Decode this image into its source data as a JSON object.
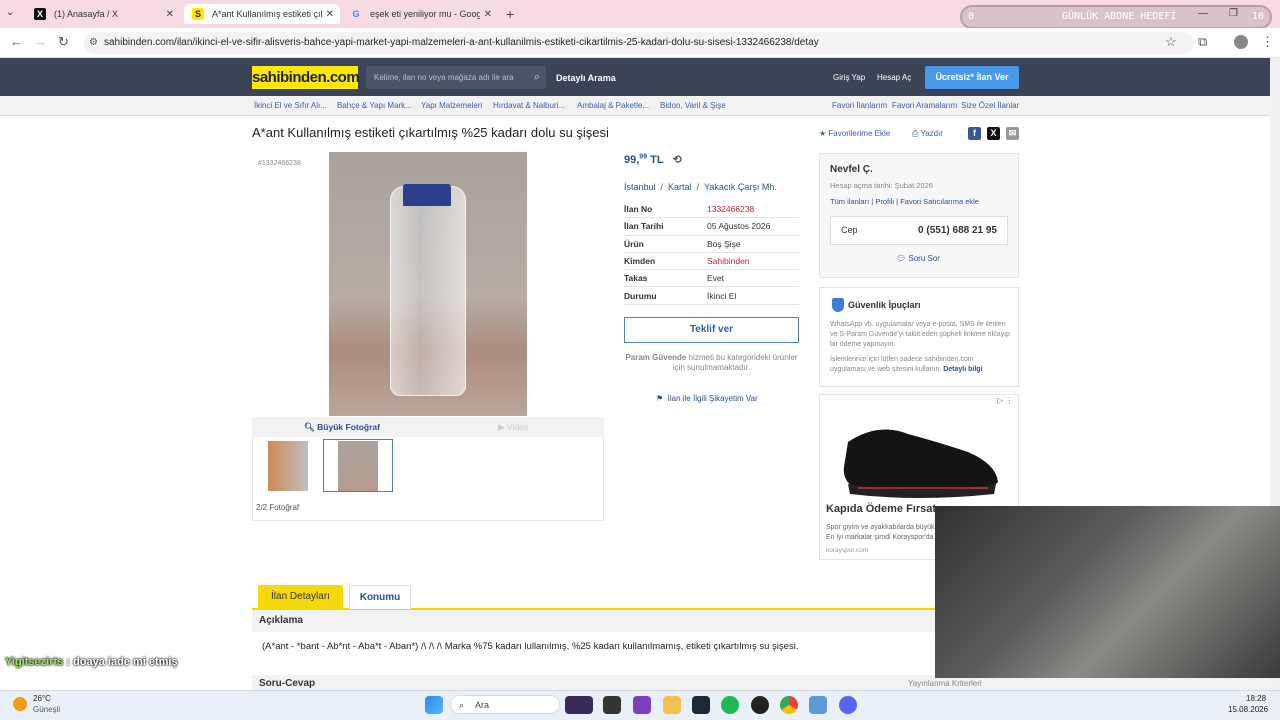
{
  "browser": {
    "tabs": [
      {
        "label": "(1) Anasayfa / X",
        "icon": "X"
      },
      {
        "label": "A*ant Kullanılmış estiketi çıkart",
        "icon": "S"
      },
      {
        "label": "eşek eti yeniliyor mu - Google'd",
        "icon": "G"
      }
    ],
    "url": "sahibinden.com/ilan/ikinci-el-ve-sifir-alisveris-bahce-yapi-market-yapi-malzemeleri-a-ant-kullanilmis-estiketi-cikartilmis-25-kadari-dolu-su-sisesi-1332466238/detay"
  },
  "overlay": {
    "goal_count_left": "0",
    "goal_label": "GÜNLÜK ABONE HEDEFİ",
    "goal_count_right": "10",
    "chat_user": "Yigitsezirts",
    "chat_message": ": doaya iade mi etmiş"
  },
  "header": {
    "logo": "sahibinden.com",
    "search_placeholder": "Kelime, ilan no veya mağaza adı ile ara",
    "detailed_search": "Detaylı Arama",
    "login": "Giriş Yap",
    "register": "Hesap Aç",
    "post_ad": "Ücretsiz* İlan Ver"
  },
  "breadcrumbs": [
    "İkinci El ve Sıfır Alı...",
    "Bahçe & Yapı Mark...",
    "Yapı Malzemeleri",
    "Hırdavat & Nalburi...",
    "Ambalaj & Paketle...",
    "Bidon, Varil & Şişe"
  ],
  "quick_links": [
    "Favori İlanlarım",
    "Favori Aramalarım",
    "Size Özel İlanlar"
  ],
  "listing": {
    "title": "A*ant Kullanılmış estiketi çıkartılmış %25 kadarı dolu su şişesi",
    "add_favorite": "Favorilerime Ekle",
    "print": "Yazdır",
    "id_label": "#1332466238",
    "big_photo": "Büyük Fotoğraf",
    "video": "Video",
    "photo_count": "2/2 Fotoğraf",
    "price_main": "99,",
    "price_cents": "99",
    "price_currency": "TL",
    "location": [
      "İstanbul",
      "Kartal",
      "Yakacık Çarşı Mh."
    ],
    "details": [
      {
        "key": "İlan No",
        "value": "1332466238"
      },
      {
        "key": "İlan Tarihi",
        "value": "05 Ağustos 2026"
      },
      {
        "key": "Ürün",
        "value": "Boş Şişe"
      },
      {
        "key": "Kimden",
        "value": "Sahibinden"
      },
      {
        "key": "Takas",
        "value": "Evet"
      },
      {
        "key": "Durumu",
        "value": "İkinci El"
      }
    ],
    "offer_button": "Teklif ver",
    "guarantee_note_1": "Param Güvende",
    "guarantee_note_2": " hizmeti bu kategorideki ürünler için sunulmamaktadır.",
    "complaint": "İlan ile İlgili Şikayetim Var"
  },
  "seller": {
    "name": "Nevfel Ç.",
    "since": "Hesap açma tarihi: Şubat 2026",
    "links": [
      "Tüm ilanları",
      "Profili",
      "Favori Satıcılarıma ekle"
    ],
    "phone_label": "Cep",
    "phone": "0 (551) 688 21 95",
    "ask": "Soru Sor"
  },
  "security": {
    "title": "Güvenlik İpuçları",
    "text1": "WhatsApp vb. uygulamalar veya e-posta, SMS ile iletilen ve S-Param Güvende'yi taklit eden şüpheli linklere tıklayıp bir ödeme yapmayın.",
    "text2": "İşlemlerinizi için lütfen sadece sahibinden.com uygulaması ve web sitesini kullanın.",
    "more": "Detaylı bilgi"
  },
  "ad": {
    "headline": "Kapıda Ödeme Fırsatı",
    "line1": "Spor giyim ve ayakkabılarda büyük",
    "line2": "En iyi markalar şimdi Korayspor'da",
    "domain": "korayspor.com"
  },
  "detail_tabs": [
    "İlan Detayları",
    "Konumu"
  ],
  "description": {
    "heading": "Açıklama",
    "text": "(A*ant - *bant - Ab*nt - Aba*t - Aban*) /\\ /\\ /\\ Marka %75 kadarı lullanılmış, %25 kadarı kullanılmamış, etiketi çıkartılmış su şişesi."
  },
  "qa": {
    "heading": "Soru-Cevap",
    "criteria": "Yayınlanma Kriterleri"
  },
  "taskbar": {
    "weather_temp": "26°C",
    "weather_desc": "Güneşli",
    "search": "Ara",
    "time": "18:28",
    "date": "15.08.2026"
  }
}
